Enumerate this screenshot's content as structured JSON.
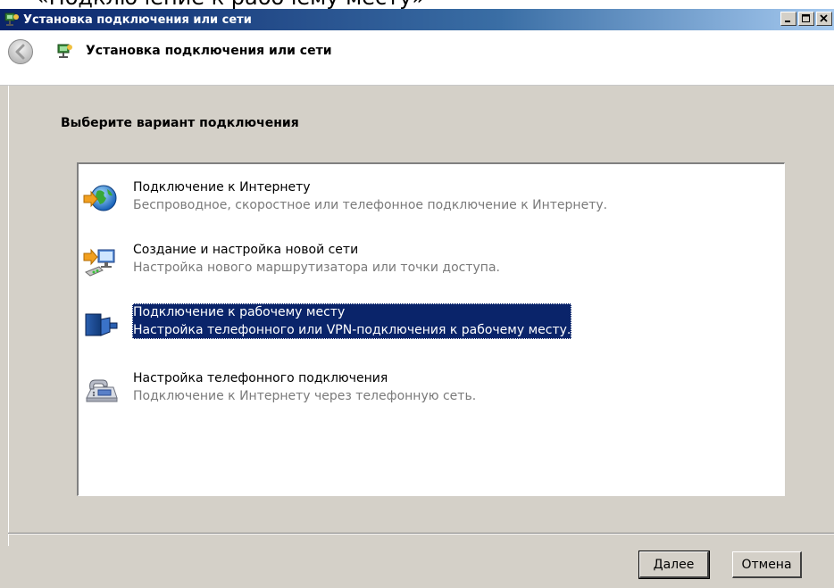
{
  "top_caption": "«Подключение к рабочему месту»",
  "window": {
    "title": "Установка подключения или сети",
    "nav_title": "Установка подключения или сети"
  },
  "main": {
    "prompt": "Выберите вариант подключения",
    "options": [
      {
        "title": "Подключение к Интернету",
        "description": "Беспроводное, скоростное или телефонное подключение к Интернету.",
        "icon": "globe-internet-icon",
        "selected": false
      },
      {
        "title": "Создание и настройка новой сети",
        "description": "Настройка нового маршрутизатора или точки доступа.",
        "icon": "network-setup-icon",
        "selected": false
      },
      {
        "title": "Подключение к рабочему месту",
        "description": "Настройка телефонного или VPN-подключения к рабочему месту.",
        "icon": "workplace-server-icon",
        "selected": true
      },
      {
        "title": "Настройка телефонного подключения",
        "description": "Подключение к Интернету через телефонную сеть.",
        "icon": "dialup-phone-icon",
        "selected": false
      }
    ]
  },
  "buttons": {
    "next": "Далее",
    "cancel": "Отмена"
  },
  "colors": {
    "selection": "#0a246a",
    "dialog_bg": "#d4d0c8",
    "description_text": "#7a7a7a"
  }
}
